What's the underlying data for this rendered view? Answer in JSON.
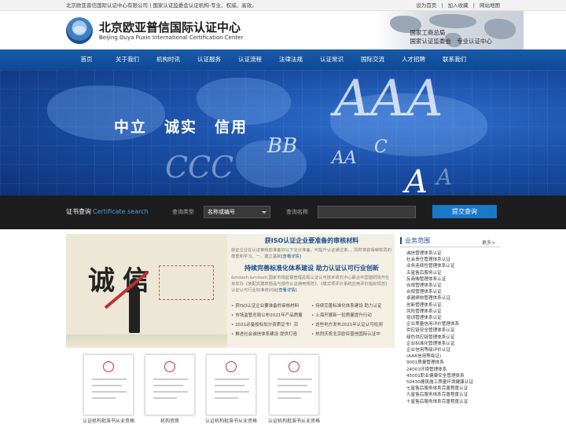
{
  "topbar": {
    "left": "北京欧亚普信国际认证中心有限公司 | 国家认证监委会认证机构-专业、权威、高效。",
    "links": [
      "设为首页",
      "|",
      "加入收藏",
      "|",
      "网站地图"
    ]
  },
  "header": {
    "name_cn": "北京欧亚普信国际认证中心",
    "name_en": "Beijing Ouya Puxin International Certification Center",
    "tags": [
      "国家工商总局",
      "国家认证监委会",
      "专业认证中心"
    ]
  },
  "nav": [
    "首页",
    "关于我们",
    "机构时讯",
    "认证服务",
    "认证流程",
    "法律法规",
    "认证常识",
    "国际交流",
    "人才招聘",
    "联系我们"
  ],
  "banner": {
    "slogan": [
      "中立",
      "诚实",
      "信用"
    ],
    "marks": [
      "AAA",
      "BB",
      "CCC",
      "AA",
      "C",
      "A",
      "A"
    ]
  },
  "search": {
    "title": "证书查询",
    "title_en": "Certificate search",
    "type_label": "查询类型",
    "type_value": "名称或编号",
    "name_label": "查询名称",
    "button": "提交查询"
  },
  "news": {
    "image_text": "诚信",
    "headline1": "获ISO认证企业要准备的审核材料",
    "para1": "获证企业在认证审核前准备好以下充分准备，可提升认证通过率，，同时将获得审核员的尊重和学习。一、建立基础",
    "para1_more": "[查看详情]",
    "headline2": "持续完善标准化体系建设 助力认证认可行业创新",
    "para2": "&mdash;&mdash;国家市场监督管理总局认证认可技术研究中心联合中国建研院开在京举办《装配式建筑部品与部件认证通用规范》、《模式项评价系统应用评价指标规范》认证认可行业标准培训会",
    "para2_more": "[查看详情]",
    "list": [
      [
        "获ISO认证企业要准备的审核材料",
        "持续完善标准化体系建设 助力认证"
      ],
      [
        "市场监管总局公布2021年产品质量",
        "上海开展新一轮质量提升行动"
      ],
      [
        "2021必备投标加分资质证书！百",
        "这些地方发布2021年认证认可检测"
      ],
      [
        "推进社会诚信体系建设 提供打造",
        "热烈庆祝北京欧亚普信国际认证中"
      ]
    ]
  },
  "certs": {
    "captions": [
      "认证机构批准书从业资格",
      "机构资质",
      "认证机构批准书从业资格",
      "认证机构批准书从业资格"
    ]
  },
  "sidebar": {
    "title": "业务范围",
    "more": "更多>",
    "items": [
      "诚信管理体系认证",
      "社会责任管理体系认证",
      "业务连续性管理体系认证",
      "五星售后服务认证",
      "反商贿管理体系认证",
      "合规管理体系认证",
      "合规管理体系认证",
      "卓越绩效管理体系认证",
      "创新管理体系认证",
      "风险管理体系认证",
      "培训管理体系认证",
      "企业质量信用评价管理体系",
      "供应链安全管理体系认证",
      "绿色供应链管理体系认证",
      "企业标准化管理体系认证",
      "企业信用等级评价认证",
      "(AAA信用等级证)",
      "9001质量管理体系",
      "24001环境管理体系",
      "45001职业健康安全管理体系",
      "50430建筑施工质量环境健康认证",
      "七星售后服务体系完善程度认证",
      "九星售后服务体系完善程度认证",
      "十星售后服务体系完善程度认证"
    ]
  }
}
